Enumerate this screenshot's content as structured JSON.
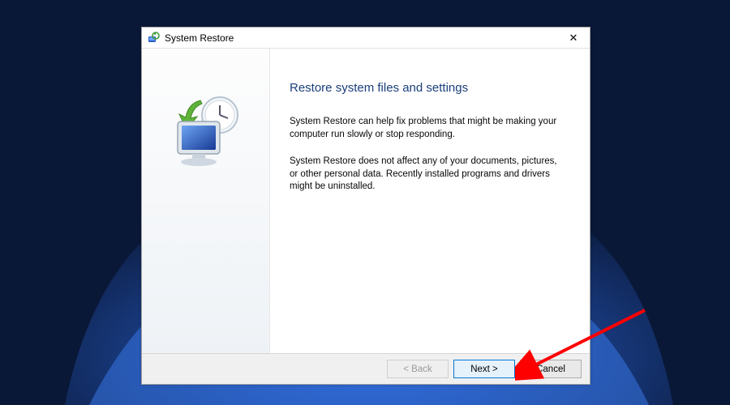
{
  "titlebar": {
    "title": "System Restore"
  },
  "content": {
    "heading": "Restore system files and settings",
    "para1": "System Restore can help fix problems that might be making your computer run slowly or stop responding.",
    "para2": "System Restore does not affect any of your documents, pictures, or other personal data. Recently installed programs and drivers might be uninstalled."
  },
  "buttons": {
    "back": "< Back",
    "next": "Next >",
    "cancel": "Cancel"
  }
}
